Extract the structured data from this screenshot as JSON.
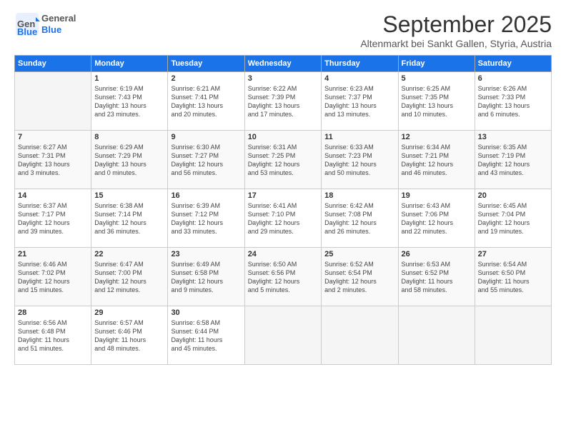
{
  "header": {
    "logo_general": "General",
    "logo_blue": "Blue",
    "title": "September 2025",
    "subtitle": "Altenmarkt bei Sankt Gallen, Styria, Austria"
  },
  "days_of_week": [
    "Sunday",
    "Monday",
    "Tuesday",
    "Wednesday",
    "Thursday",
    "Friday",
    "Saturday"
  ],
  "weeks": [
    [
      {
        "day": "",
        "info": ""
      },
      {
        "day": "1",
        "info": "Sunrise: 6:19 AM\nSunset: 7:43 PM\nDaylight: 13 hours\nand 23 minutes."
      },
      {
        "day": "2",
        "info": "Sunrise: 6:21 AM\nSunset: 7:41 PM\nDaylight: 13 hours\nand 20 minutes."
      },
      {
        "day": "3",
        "info": "Sunrise: 6:22 AM\nSunset: 7:39 PM\nDaylight: 13 hours\nand 17 minutes."
      },
      {
        "day": "4",
        "info": "Sunrise: 6:23 AM\nSunset: 7:37 PM\nDaylight: 13 hours\nand 13 minutes."
      },
      {
        "day": "5",
        "info": "Sunrise: 6:25 AM\nSunset: 7:35 PM\nDaylight: 13 hours\nand 10 minutes."
      },
      {
        "day": "6",
        "info": "Sunrise: 6:26 AM\nSunset: 7:33 PM\nDaylight: 13 hours\nand 6 minutes."
      }
    ],
    [
      {
        "day": "7",
        "info": "Sunrise: 6:27 AM\nSunset: 7:31 PM\nDaylight: 13 hours\nand 3 minutes."
      },
      {
        "day": "8",
        "info": "Sunrise: 6:29 AM\nSunset: 7:29 PM\nDaylight: 13 hours\nand 0 minutes."
      },
      {
        "day": "9",
        "info": "Sunrise: 6:30 AM\nSunset: 7:27 PM\nDaylight: 12 hours\nand 56 minutes."
      },
      {
        "day": "10",
        "info": "Sunrise: 6:31 AM\nSunset: 7:25 PM\nDaylight: 12 hours\nand 53 minutes."
      },
      {
        "day": "11",
        "info": "Sunrise: 6:33 AM\nSunset: 7:23 PM\nDaylight: 12 hours\nand 50 minutes."
      },
      {
        "day": "12",
        "info": "Sunrise: 6:34 AM\nSunset: 7:21 PM\nDaylight: 12 hours\nand 46 minutes."
      },
      {
        "day": "13",
        "info": "Sunrise: 6:35 AM\nSunset: 7:19 PM\nDaylight: 12 hours\nand 43 minutes."
      }
    ],
    [
      {
        "day": "14",
        "info": "Sunrise: 6:37 AM\nSunset: 7:17 PM\nDaylight: 12 hours\nand 39 minutes."
      },
      {
        "day": "15",
        "info": "Sunrise: 6:38 AM\nSunset: 7:14 PM\nDaylight: 12 hours\nand 36 minutes."
      },
      {
        "day": "16",
        "info": "Sunrise: 6:39 AM\nSunset: 7:12 PM\nDaylight: 12 hours\nand 33 minutes."
      },
      {
        "day": "17",
        "info": "Sunrise: 6:41 AM\nSunset: 7:10 PM\nDaylight: 12 hours\nand 29 minutes."
      },
      {
        "day": "18",
        "info": "Sunrise: 6:42 AM\nSunset: 7:08 PM\nDaylight: 12 hours\nand 26 minutes."
      },
      {
        "day": "19",
        "info": "Sunrise: 6:43 AM\nSunset: 7:06 PM\nDaylight: 12 hours\nand 22 minutes."
      },
      {
        "day": "20",
        "info": "Sunrise: 6:45 AM\nSunset: 7:04 PM\nDaylight: 12 hours\nand 19 minutes."
      }
    ],
    [
      {
        "day": "21",
        "info": "Sunrise: 6:46 AM\nSunset: 7:02 PM\nDaylight: 12 hours\nand 15 minutes."
      },
      {
        "day": "22",
        "info": "Sunrise: 6:47 AM\nSunset: 7:00 PM\nDaylight: 12 hours\nand 12 minutes."
      },
      {
        "day": "23",
        "info": "Sunrise: 6:49 AM\nSunset: 6:58 PM\nDaylight: 12 hours\nand 9 minutes."
      },
      {
        "day": "24",
        "info": "Sunrise: 6:50 AM\nSunset: 6:56 PM\nDaylight: 12 hours\nand 5 minutes."
      },
      {
        "day": "25",
        "info": "Sunrise: 6:52 AM\nSunset: 6:54 PM\nDaylight: 12 hours\nand 2 minutes."
      },
      {
        "day": "26",
        "info": "Sunrise: 6:53 AM\nSunset: 6:52 PM\nDaylight: 11 hours\nand 58 minutes."
      },
      {
        "day": "27",
        "info": "Sunrise: 6:54 AM\nSunset: 6:50 PM\nDaylight: 11 hours\nand 55 minutes."
      }
    ],
    [
      {
        "day": "28",
        "info": "Sunrise: 6:56 AM\nSunset: 6:48 PM\nDaylight: 11 hours\nand 51 minutes."
      },
      {
        "day": "29",
        "info": "Sunrise: 6:57 AM\nSunset: 6:46 PM\nDaylight: 11 hours\nand 48 minutes."
      },
      {
        "day": "30",
        "info": "Sunrise: 6:58 AM\nSunset: 6:44 PM\nDaylight: 11 hours\nand 45 minutes."
      },
      {
        "day": "",
        "info": ""
      },
      {
        "day": "",
        "info": ""
      },
      {
        "day": "",
        "info": ""
      },
      {
        "day": "",
        "info": ""
      }
    ]
  ]
}
